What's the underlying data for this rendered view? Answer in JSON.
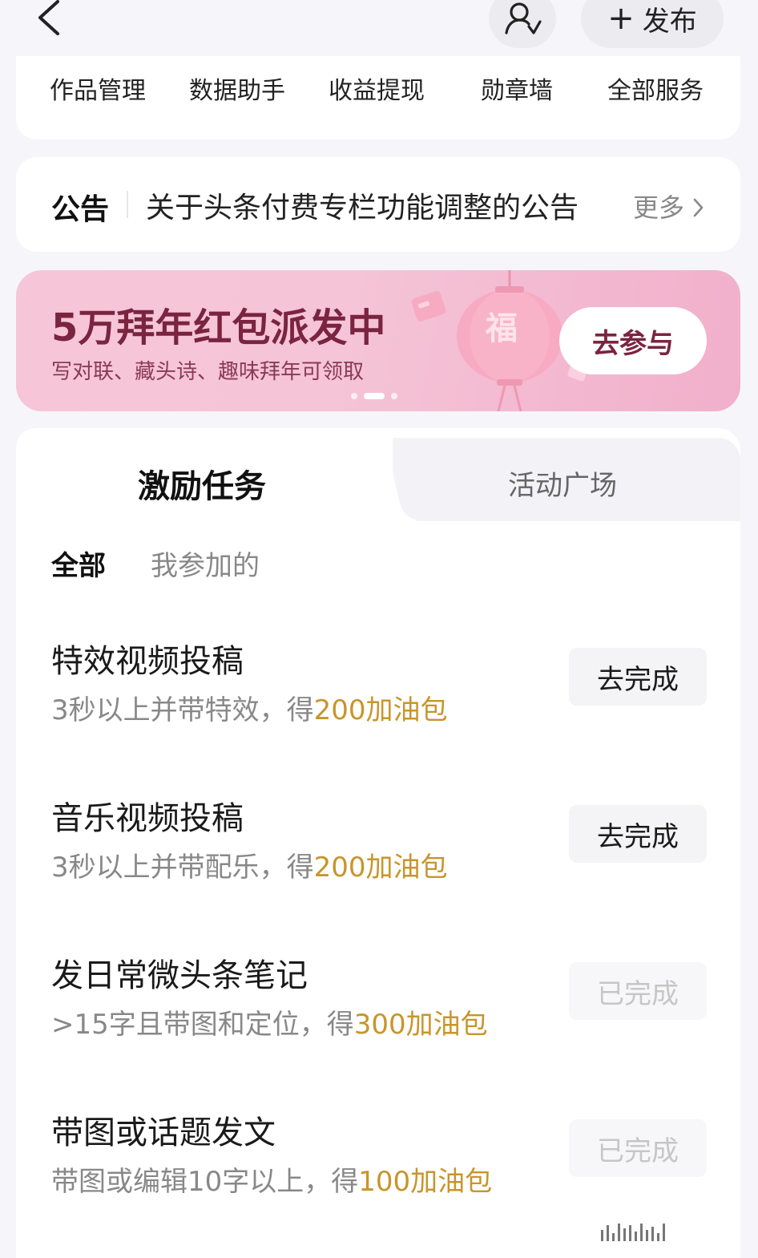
{
  "header": {
    "publish_label": "发布"
  },
  "services": [
    {
      "label": "作品管理"
    },
    {
      "label": "数据助手"
    },
    {
      "label": "收益提现"
    },
    {
      "label": "勋章墙"
    },
    {
      "label": "全部服务"
    }
  ],
  "notice": {
    "tag": "公告",
    "text": "关于头条付费专栏功能调整的公告",
    "more": "更多"
  },
  "banner": {
    "title": "5万拜年红包派发中",
    "subtitle": "写对联、藏头诗、趣味拜年可领取",
    "cta": "去参与",
    "deco_char": "福",
    "slide_count": 3,
    "active_slide": 2
  },
  "tabs": [
    {
      "label": "激励任务",
      "active": true
    },
    {
      "label": "活动广场",
      "active": false
    }
  ],
  "filters": {
    "all": "全部",
    "mine": "我参加的"
  },
  "tasks": [
    {
      "title": "特效视频投稿",
      "desc_prefix": "3秒以上并带特效，得",
      "reward": "200加油包",
      "button": "去完成",
      "status": "todo"
    },
    {
      "title": "音乐视频投稿",
      "desc_prefix": "3秒以上并带配乐，得",
      "reward": "200加油包",
      "button": "去完成",
      "status": "todo"
    },
    {
      "title": "发日常微头条笔记",
      "desc_prefix": ">15字且带图和定位，得",
      "reward": "300加油包",
      "button": "已完成",
      "status": "done"
    },
    {
      "title": "带图或话题发文",
      "desc_prefix": "带图或编辑10字以上，得",
      "reward": "100加油包",
      "button": "已完成",
      "status": "done"
    }
  ],
  "colors": {
    "reward": "#c8952c",
    "banner_text": "#7a2440",
    "background": "#f6f6fa"
  }
}
